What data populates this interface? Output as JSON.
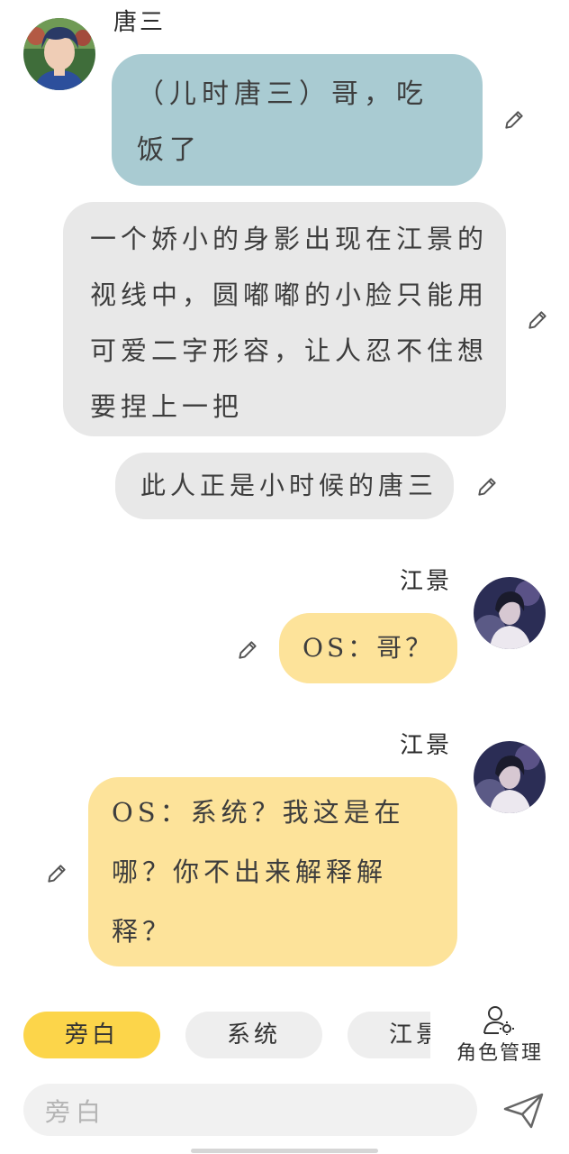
{
  "chat": {
    "msg1": {
      "speaker": "唐三",
      "lines": [
        "（儿时唐三）哥，吃",
        "饭了"
      ]
    },
    "narration1": {
      "lines": [
        "一个娇小的身影出现在江景的",
        "视线中，圆嘟嘟的小脸只能用",
        "可爱二字形容，让人忍不住想",
        "要捏上一把"
      ]
    },
    "narration2": {
      "text": "此人正是小时候的唐三"
    },
    "msg2": {
      "speaker": "江景",
      "text": "OS：哥？"
    },
    "msg3": {
      "speaker": "江景",
      "lines": [
        "OS：系统？我这是在",
        "哪？你不出来解释解",
        "释？"
      ]
    }
  },
  "role_chips": [
    {
      "label": "旁白",
      "active": true
    },
    {
      "label": "系统",
      "active": false
    },
    {
      "label": "江景",
      "active": false
    }
  ],
  "role_manager": {
    "label": "角色管理",
    "icon": "user-gear-icon"
  },
  "composer": {
    "placeholder": "旁白",
    "send_icon": "send-icon"
  },
  "colors": {
    "bubble_blue": "#a9cbd2",
    "bubble_gray": "#e8e8e8",
    "bubble_yellow": "#fde39a",
    "chip_active": "#fcd54a",
    "chip_inactive": "#eeeeee"
  }
}
